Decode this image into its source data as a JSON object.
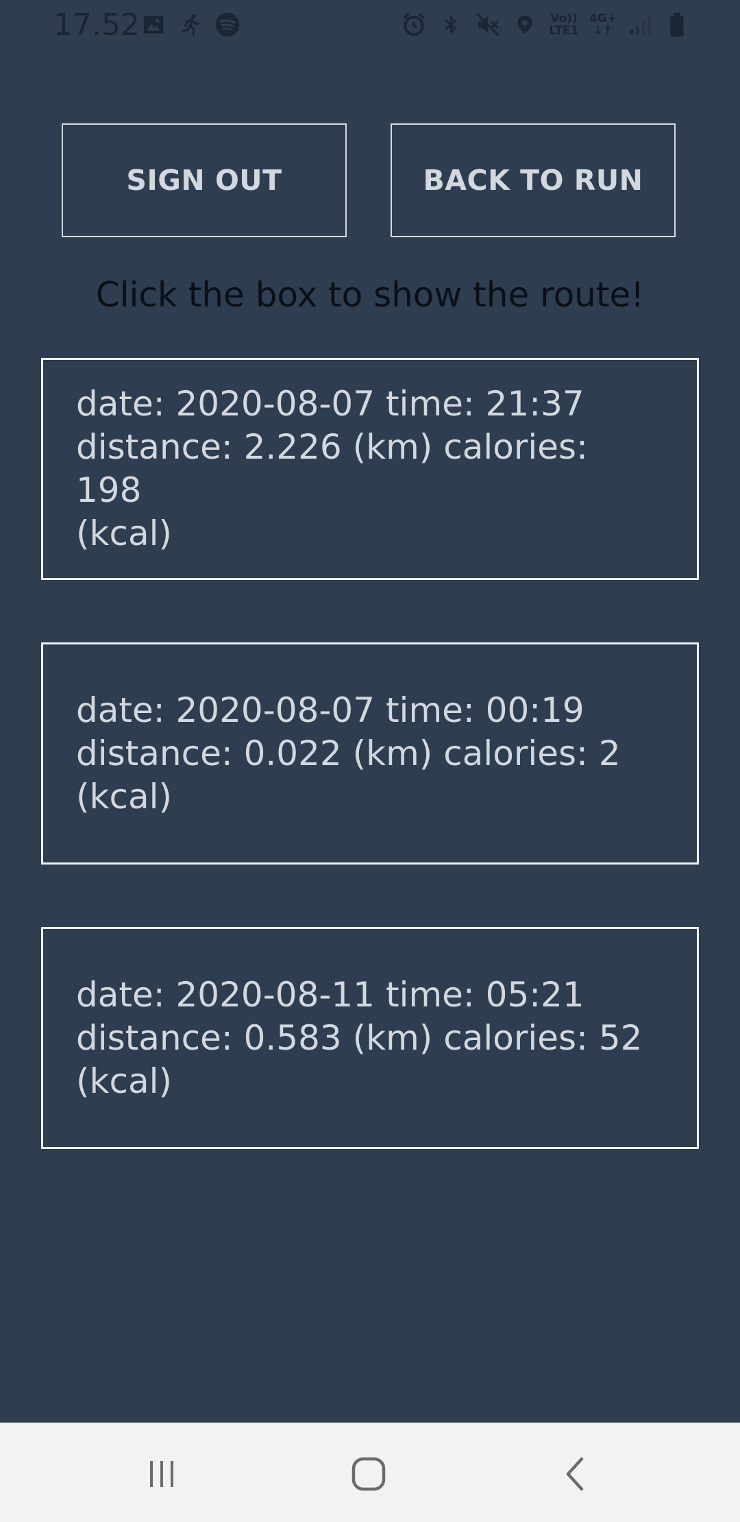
{
  "status_bar": {
    "time": "17.52",
    "left_icons": [
      "image-icon",
      "running-icon",
      "spotify-icon"
    ],
    "right_icons": [
      "alarm-icon",
      "bluetooth-icon",
      "mute-icon",
      "location-icon",
      "volte-icon",
      "4g-icon",
      "signal-icon",
      "battery-icon"
    ],
    "volte_top": "Vo))",
    "volte_bottom": "LTE1",
    "network_top": "4G+",
    "network_bottom": "↓↑"
  },
  "buttons": {
    "sign_out": "SIGN OUT",
    "back_to_run": "BACK TO RUN"
  },
  "instruction": "Click the box to show the route!",
  "runs": [
    {
      "text": "date: 2020-08-07 time: 21:37\ndistance: 2.226 (km) calories: 198\n(kcal)"
    },
    {
      "text": "date: 2020-08-07 time: 00:19\ndistance: 0.022 (km) calories: 2\n(kcal)"
    },
    {
      "text": "date: 2020-08-11 time: 05:21\ndistance: 0.583 (km) calories: 52\n(kcal)"
    }
  ],
  "nav_bar": {
    "icons": [
      "recents-icon",
      "home-icon",
      "back-icon"
    ]
  },
  "colors": {
    "background": "#2e3d50",
    "button_text": "#d3d8df",
    "card_border": "#eef1f5",
    "nav_background": "#f2f2f2"
  }
}
